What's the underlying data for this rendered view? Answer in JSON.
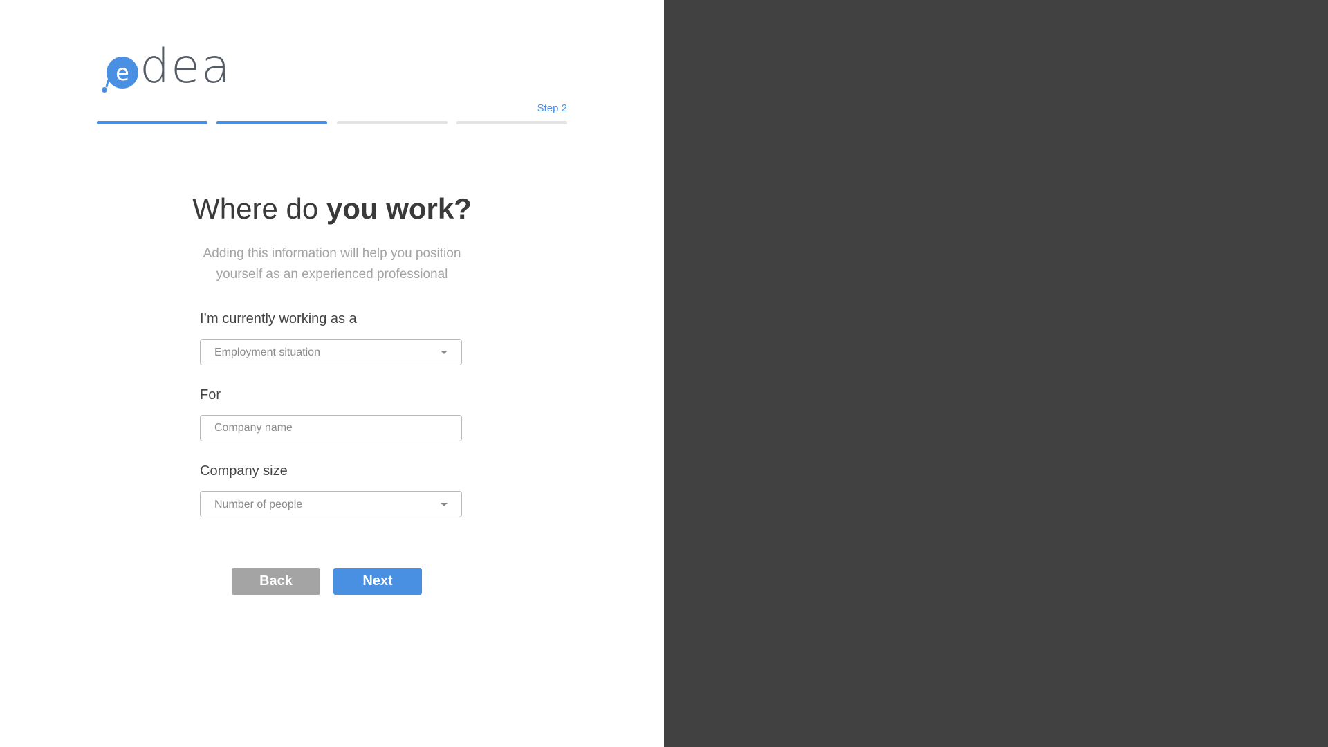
{
  "brand": {
    "logo_text": "dea",
    "logo_letter": "e",
    "accent_color": "#4a90e2",
    "side_panel_color": "#414141"
  },
  "progress": {
    "step_label": "Step 2",
    "total_steps": 4,
    "completed_steps": 2
  },
  "heading": {
    "prefix": "Where do",
    "emphasis": "you work?"
  },
  "subtitle": "Adding this information will help you position yourself as an experienced professional",
  "form": {
    "employment": {
      "label": "I’m currently working as a",
      "placeholder": "Employment situation"
    },
    "company": {
      "label": "For",
      "placeholder": "Company name"
    },
    "company_size": {
      "label": "Company size",
      "placeholder": "Number of people"
    }
  },
  "buttons": {
    "back_label": "Back",
    "next_label": "Next"
  }
}
